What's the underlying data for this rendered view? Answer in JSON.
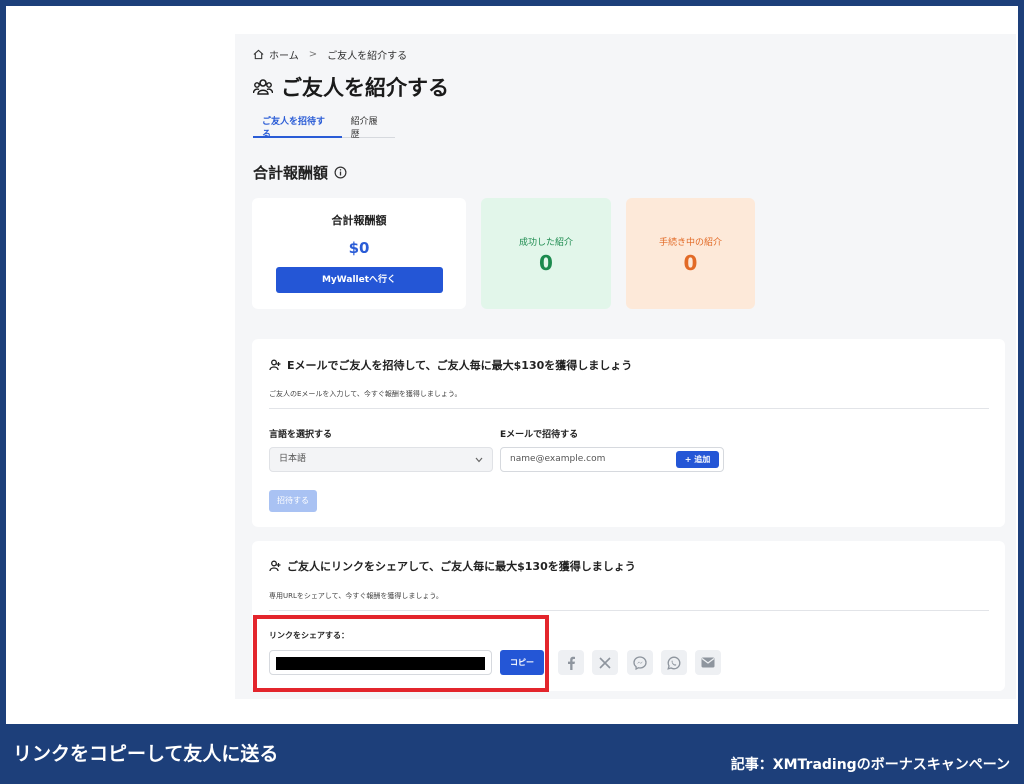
{
  "breadcrumb": {
    "home": "ホーム",
    "separator": ">",
    "current": "ご友人を紹介する"
  },
  "page": {
    "title": "ご友人を紹介する"
  },
  "tabs": [
    {
      "label": "ご友人を招待する",
      "active": true
    },
    {
      "label": "紹介履歴",
      "active": false
    }
  ],
  "summary": {
    "title": "合計報酬額",
    "total_label": "合計報酬額",
    "total_amount": "$0",
    "wallet_button": "MyWalletへ行く",
    "success_label": "成功した紹介",
    "success_count": "0",
    "pending_label": "手続き中の紹介",
    "pending_count": "0"
  },
  "email_invite": {
    "heading": "Eメールでご友人を招待して、ご友人毎に最大$130を獲得しましょう",
    "subtext": "ご友人のEメールを入力して、今すぐ報酬を獲得しましょう。",
    "language_label": "言語を選択する",
    "language_value": "日本語",
    "email_label": "Eメールで招待する",
    "email_placeholder": "name@example.com",
    "add_button": "+ 追加",
    "invite_button": "招待する"
  },
  "link_share": {
    "heading": "ご友人にリンクをシェアして、ご友人毎に最大$130を獲得しましょう",
    "subtext": "専用URLをシェアして、今すぐ報酬を獲得しましょう。",
    "share_label": "リンクをシェアする：",
    "copy_button": "コピー",
    "share_icons": [
      "facebook-icon",
      "x-icon",
      "messenger-icon",
      "whatsapp-icon",
      "mail-icon"
    ]
  },
  "footer": {
    "caption": "リンクをコピーして友人に送る",
    "credit": "記事：XMTradingのボーナスキャンペーン"
  },
  "colors": {
    "accent": "#2456d6",
    "success": "#1c8a4e",
    "pending": "#e26a26",
    "highlight": "#e3252c",
    "frame": "#1d3f7a"
  }
}
